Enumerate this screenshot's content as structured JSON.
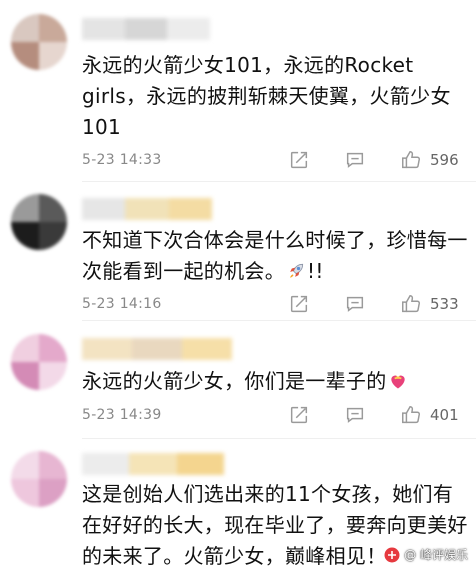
{
  "comments": [
    {
      "text": "永远的火箭少女101，永远的Rocket girls，永远的披荆斩棘天使翼，火箭少女101",
      "time": "5-23 14:33",
      "likes": "596"
    },
    {
      "text": "不知道下次合体会是什么时候了，珍惜每一次能看到一起的机会。",
      "text_tail": "!!",
      "time": "5-23 14:16",
      "likes": "533",
      "emoji": "rocket-emoji"
    },
    {
      "text": "永远的火箭少女，你们是一辈子的",
      "time": "5-23 14:39",
      "likes": "401",
      "emoji": "heart-ribbon-emoji"
    },
    {
      "text": "这是创始人们选出来的11个女孩，她们有在好好的长大，现在毕业了，要奔向更美好的未来了。火箭少女，巅峰相见！"
    }
  ],
  "icons": {
    "share": "share-icon",
    "reply": "comment-icon",
    "like": "thumbs-up-icon"
  },
  "watermark": {
    "text": "@ 峰评娱乐"
  },
  "colors": {
    "text": "#111111",
    "meta": "#888888",
    "icon": "#9a9a9a"
  }
}
